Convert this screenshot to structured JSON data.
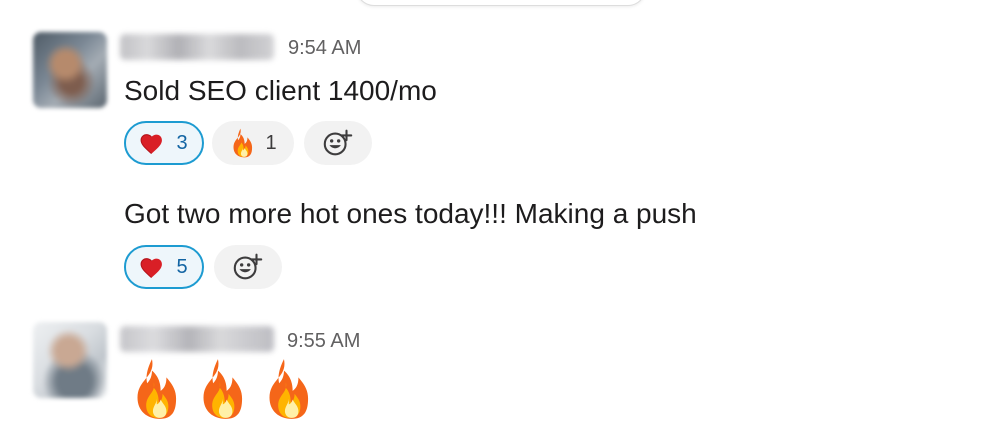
{
  "messages": [
    {
      "time": "9:54 AM",
      "items": [
        {
          "text": "Sold SEO client 1400/mo",
          "reactions": [
            {
              "icon": "heart-icon",
              "count": "3",
              "active": true,
              "color": "#1d9bd1"
            },
            {
              "icon": "fire-icon",
              "count": "1",
              "active": false,
              "color": "#f4f4f4"
            }
          ]
        },
        {
          "text": "Got two more hot ones today!!! Making a push",
          "reactions": [
            {
              "icon": "heart-icon",
              "count": "5",
              "active": true,
              "color": "#1d9bd1"
            }
          ]
        }
      ]
    },
    {
      "time": "9:55 AM",
      "items": [
        {
          "emojis": [
            "fire-icon",
            "fire-icon",
            "fire-icon"
          ]
        }
      ]
    }
  ],
  "colors": {
    "text": "#1d1c1d",
    "timestamp": "#616061",
    "active_reaction_border": "#1d9bd1",
    "active_reaction_count": "#1264a3",
    "reaction_bg": "#f2f2f2"
  }
}
